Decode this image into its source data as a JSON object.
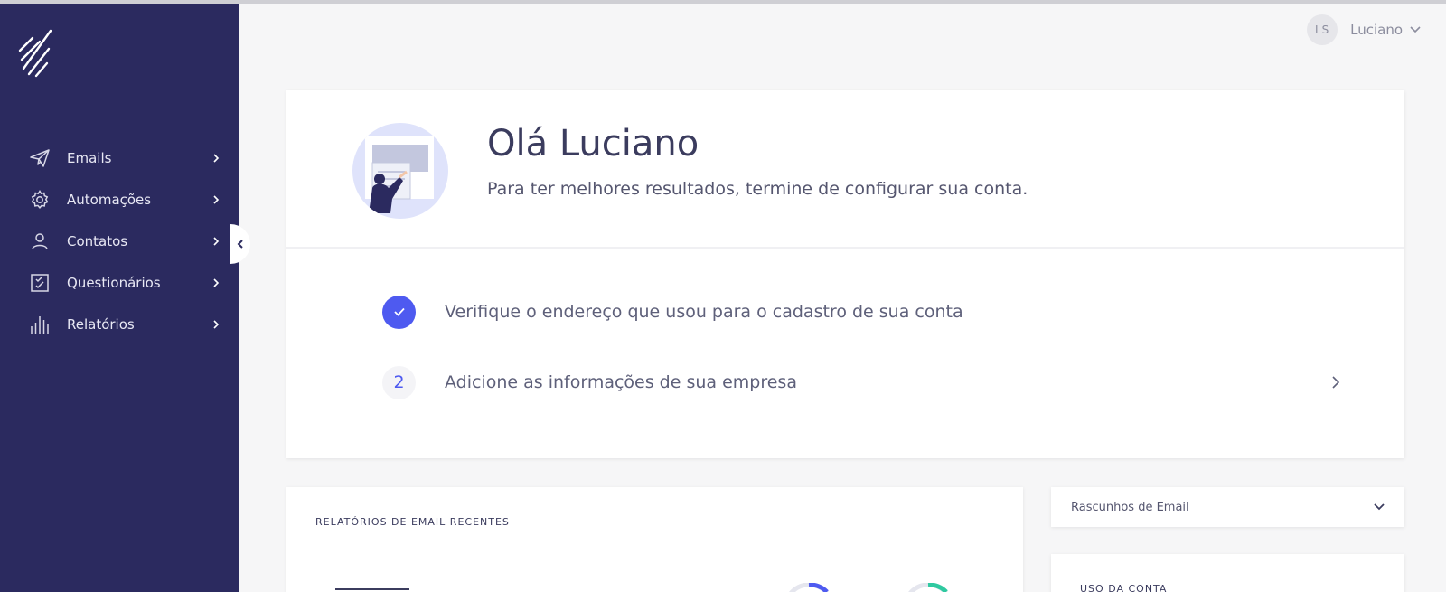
{
  "user": {
    "initials": "LS",
    "name": "Luciano"
  },
  "sidebar": {
    "items": [
      {
        "label": "Emails",
        "icon": "paper-plane-icon"
      },
      {
        "label": "Automações",
        "icon": "gear-icon"
      },
      {
        "label": "Contatos",
        "icon": "person-icon"
      },
      {
        "label": "Questionários",
        "icon": "checklist-icon"
      },
      {
        "label": "Relatórios",
        "icon": "bar-chart-icon"
      }
    ]
  },
  "welcome": {
    "title": "Olá Luciano",
    "subtitle": "Para ter melhores resultados, termine de configurar sua conta."
  },
  "steps": [
    {
      "status": "done",
      "text": "Verifique o endereço que usou para o cadastro de sua conta"
    },
    {
      "number": "2",
      "text": "Adicione as informações de sua empresa"
    }
  ],
  "reports": {
    "title": "RELATÓRIOS DE EMAIL RECENTES"
  },
  "drafts": {
    "label": "Rascunhos de Email"
  },
  "usage": {
    "title": "USO DA CONTA"
  },
  "colors": {
    "sidebar": "#2b2a5f",
    "accent": "#4e5af0",
    "green": "#2fc9a0"
  }
}
